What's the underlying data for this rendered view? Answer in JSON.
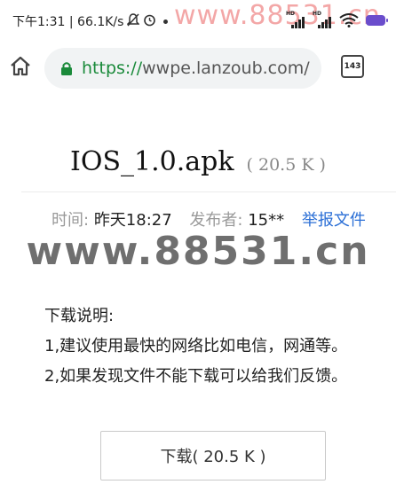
{
  "status_bar": {
    "time_speed": "下午1:31 | 66.1K/s",
    "watermark": "www.88531.cn"
  },
  "browser": {
    "url_scheme": "https://",
    "url_rest": "wwpe.lanzoub.com/",
    "tab_count": "143"
  },
  "file": {
    "name": "IOS_1.0.apk",
    "size": "( 20.5 K )"
  },
  "meta": {
    "time_label": "时间:",
    "time_value": "昨天18:27",
    "publisher_label": "发布者:",
    "publisher_value": "15**",
    "report_link": "举报文件"
  },
  "watermark_center": "www.88531.cn",
  "description": {
    "heading": "下载说明:",
    "line1": "1,建议使用最快的网络比如电信，网通等。",
    "line2": "2,如果发现文件不能下载可以给我们反馈。"
  },
  "download_button_label": "下载( 20.5 K )",
  "colors": {
    "https_green": "#1a8a3a",
    "link_blue": "#2b6fd6",
    "battery_purple": "#6a4dcc"
  }
}
